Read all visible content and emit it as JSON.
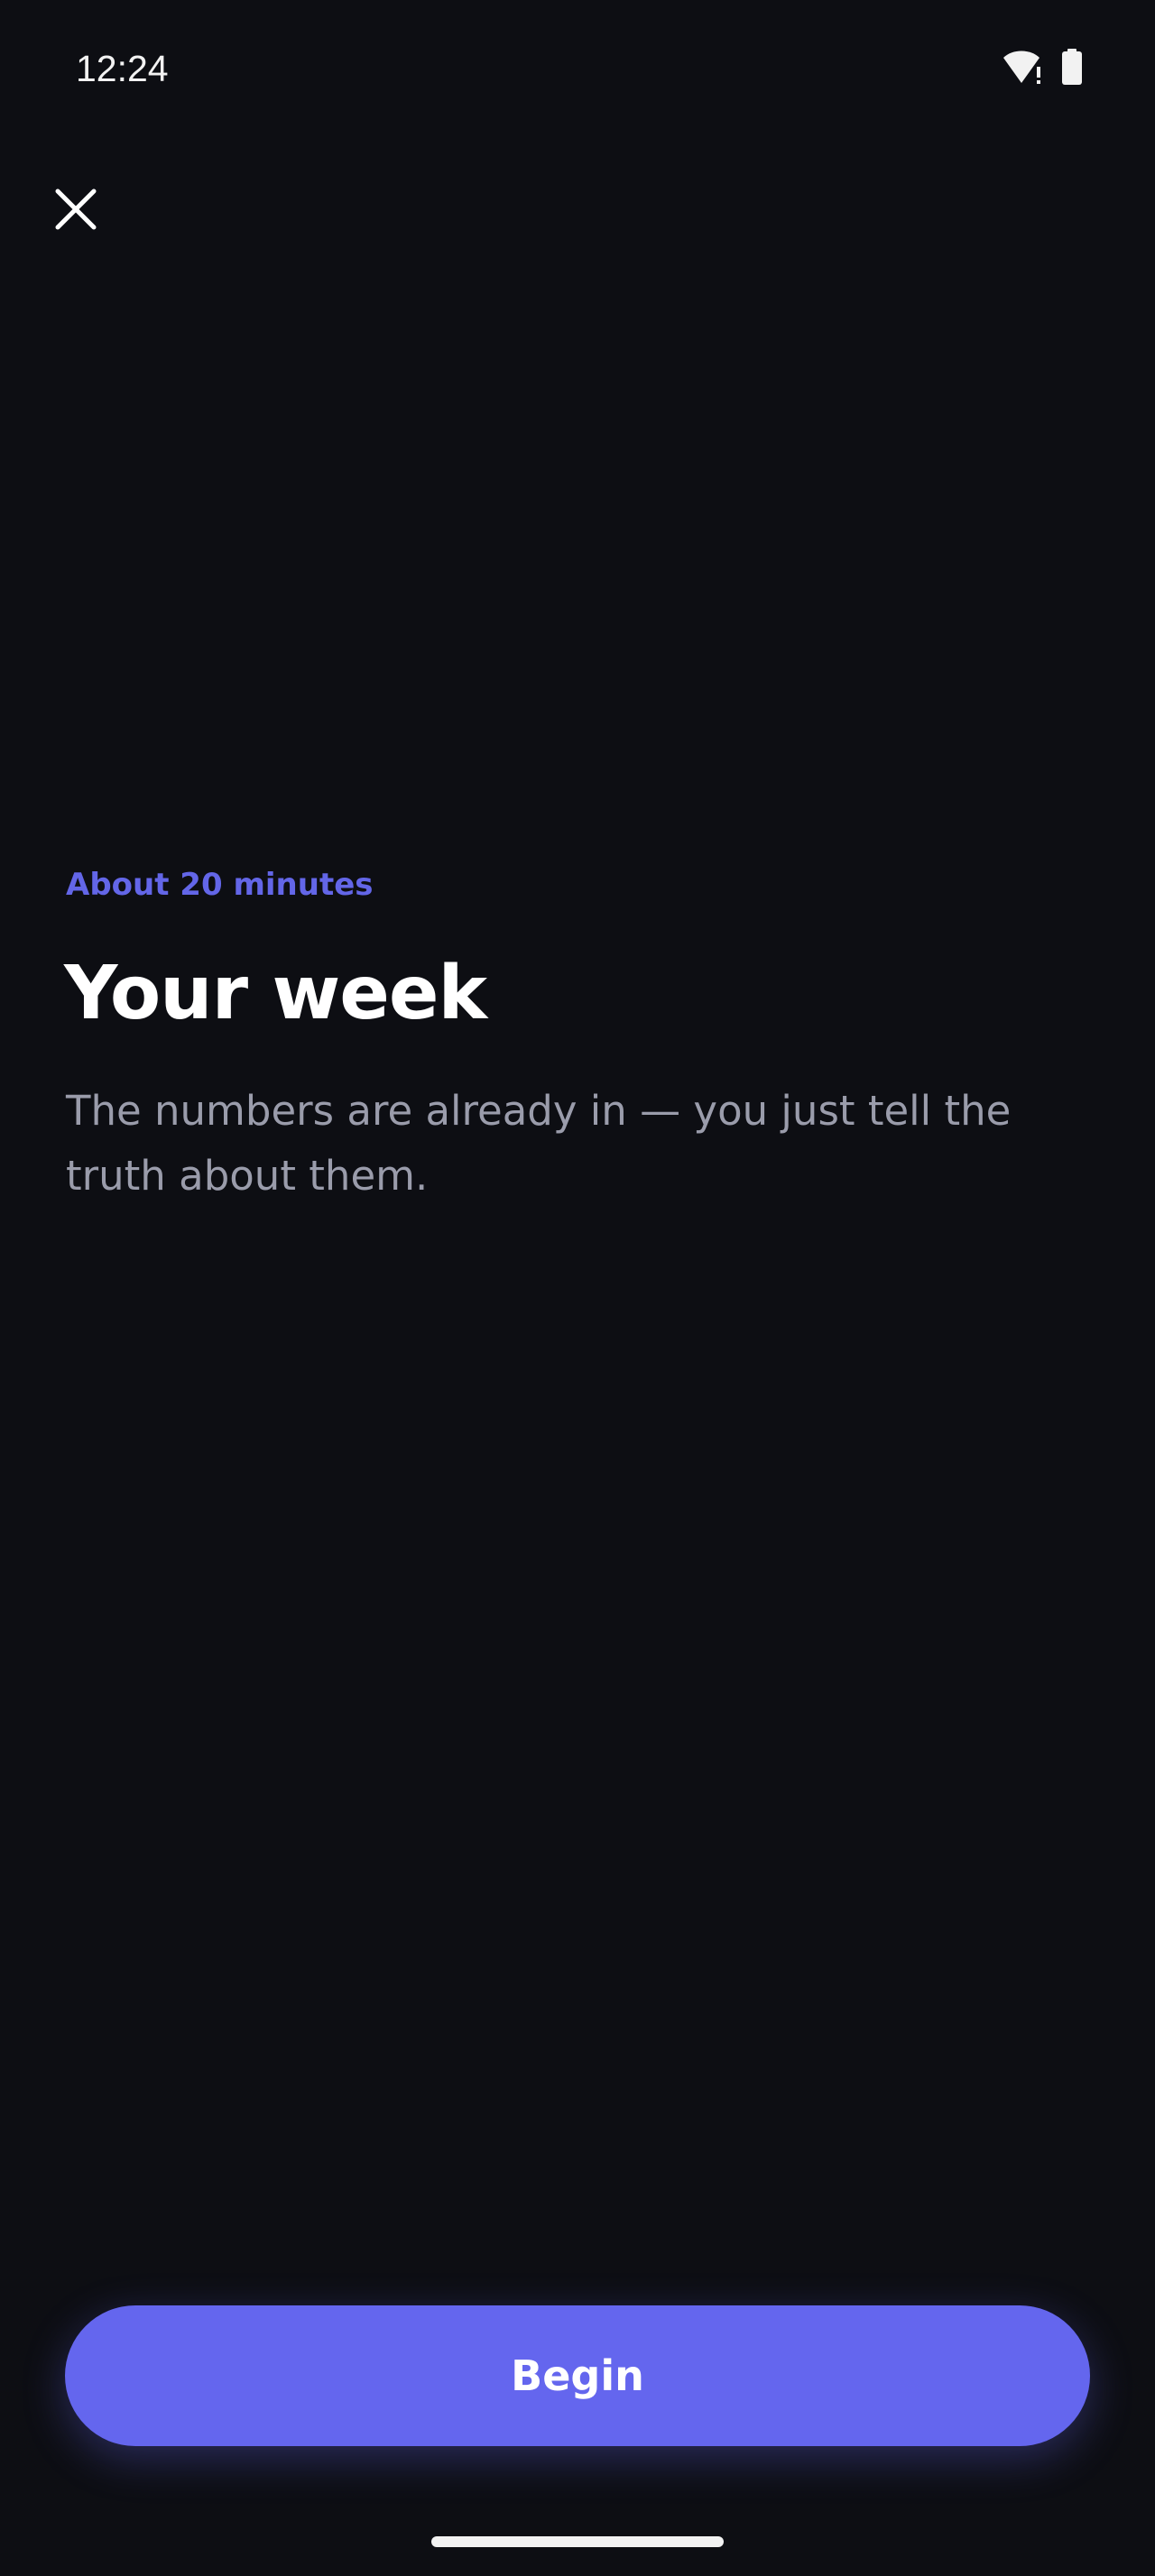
{
  "status_bar": {
    "time": "12:24",
    "icons": [
      "wifi-alert-icon",
      "battery-icon"
    ]
  },
  "header": {
    "close_icon": "close-icon"
  },
  "intro": {
    "eyebrow": "About 20 minutes",
    "title": "Your week",
    "subtitle": "The numbers are already in — you just tell the truth about them."
  },
  "actions": {
    "begin_label": "Begin"
  },
  "colors": {
    "background": "#0d0e13",
    "accent": "#6466ee",
    "eyebrow": "#6366e8",
    "subtitle": "#9a9cab"
  }
}
